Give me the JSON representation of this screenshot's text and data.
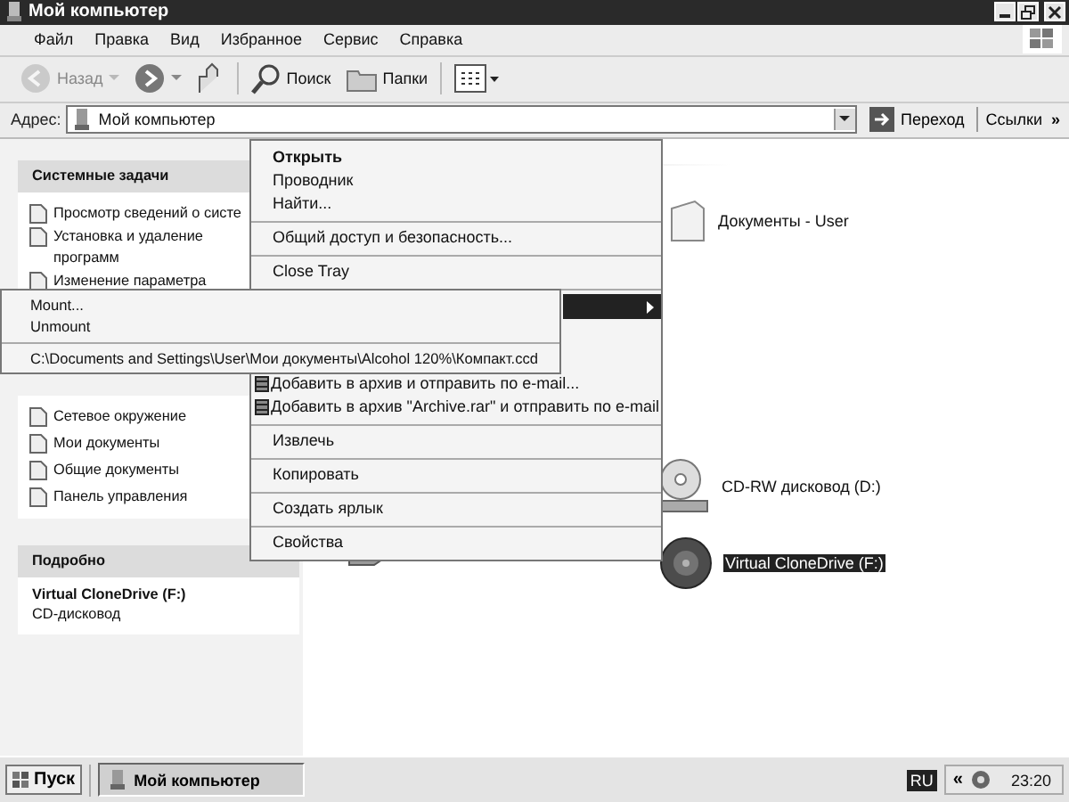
{
  "window": {
    "title": "Мой компьютер"
  },
  "menu_bar": [
    "Файл",
    "Правка",
    "Вид",
    "Избранное",
    "Сервис",
    "Справка"
  ],
  "toolbar": [
    {
      "kind": "back",
      "label": "Назад",
      "disabled": true
    },
    {
      "kind": "forward",
      "disabled": false
    },
    {
      "kind": "up",
      "disabled": false
    },
    {
      "kind": "search",
      "label": "Поиск",
      "disabled": false
    },
    {
      "kind": "folders",
      "label": "Папки",
      "disabled": false
    },
    {
      "kind": "views",
      "disabled": false
    }
  ],
  "address_bar": {
    "label": "Адрес:",
    "value": "Мой компьютер",
    "go": "Переход",
    "links": "Ссылки",
    "more": "»"
  },
  "task_panels": [
    {
      "title": "Системные задачи",
      "items": [
        "Просмотр сведений о систе",
        "Установка и удаление программ",
        "Изменение параметра"
      ]
    },
    {
      "items": [
        "Сетевое окружение",
        "Мои документы",
        "Общие документы",
        "Панель управления"
      ]
    }
  ],
  "details": {
    "title": "Подробно",
    "name": "Virtual CloneDrive (F:)",
    "type": "CD-дисковод"
  },
  "files": [
    {
      "kind": "folder",
      "label": "Документы - User",
      "selected": false
    },
    {
      "kind": "cd",
      "label": "CD-RW дисковод (D:)",
      "selected": false
    },
    {
      "kind": "hdd",
      "selected": false
    },
    {
      "kind": "virtual",
      "label": "Virtual CloneDrive (F:)",
      "selected": true
    }
  ],
  "context_menu": [
    {
      "kind": "default",
      "label": "Открыть"
    },
    {
      "kind": "item",
      "label": "Проводник"
    },
    {
      "kind": "item",
      "label": "Найти..."
    },
    {
      "kind": "separator"
    },
    {
      "kind": "item",
      "label": "Общий доступ и безопасность..."
    },
    {
      "kind": "separator"
    },
    {
      "kind": "item",
      "label": "Close Tray"
    },
    {
      "kind": "separator"
    },
    {
      "kind": "submenu",
      "highlighted": true
    },
    {
      "kind": "archive",
      "label": "Добавить в архив и отправить по e-mail..."
    },
    {
      "kind": "archive",
      "label": "Добавить в архив \"Archive.rar\" и отправить по e-mail"
    },
    {
      "kind": "separator"
    },
    {
      "kind": "item",
      "label": "Извлечь"
    },
    {
      "kind": "separator"
    },
    {
      "kind": "item",
      "label": "Копировать"
    },
    {
      "kind": "separator"
    },
    {
      "kind": "item",
      "label": "Создать ярлык"
    },
    {
      "kind": "separator"
    },
    {
      "kind": "item",
      "label": "Свойства"
    }
  ],
  "submenu": [
    {
      "kind": "item",
      "label": "Mount..."
    },
    {
      "kind": "item",
      "label": "Unmount"
    },
    {
      "kind": "separator"
    },
    {
      "kind": "item",
      "label": "C:\\Documents and Settings\\User\\Мои документы\\Alcohol 120%\\Компакт.ccd"
    }
  ],
  "taskbar": {
    "start": "Пуск",
    "tasks": [
      {
        "label": "Мой компьютер",
        "selected": true
      }
    ],
    "language": "RU",
    "tray_toggle": "«",
    "clock": "23:20"
  }
}
